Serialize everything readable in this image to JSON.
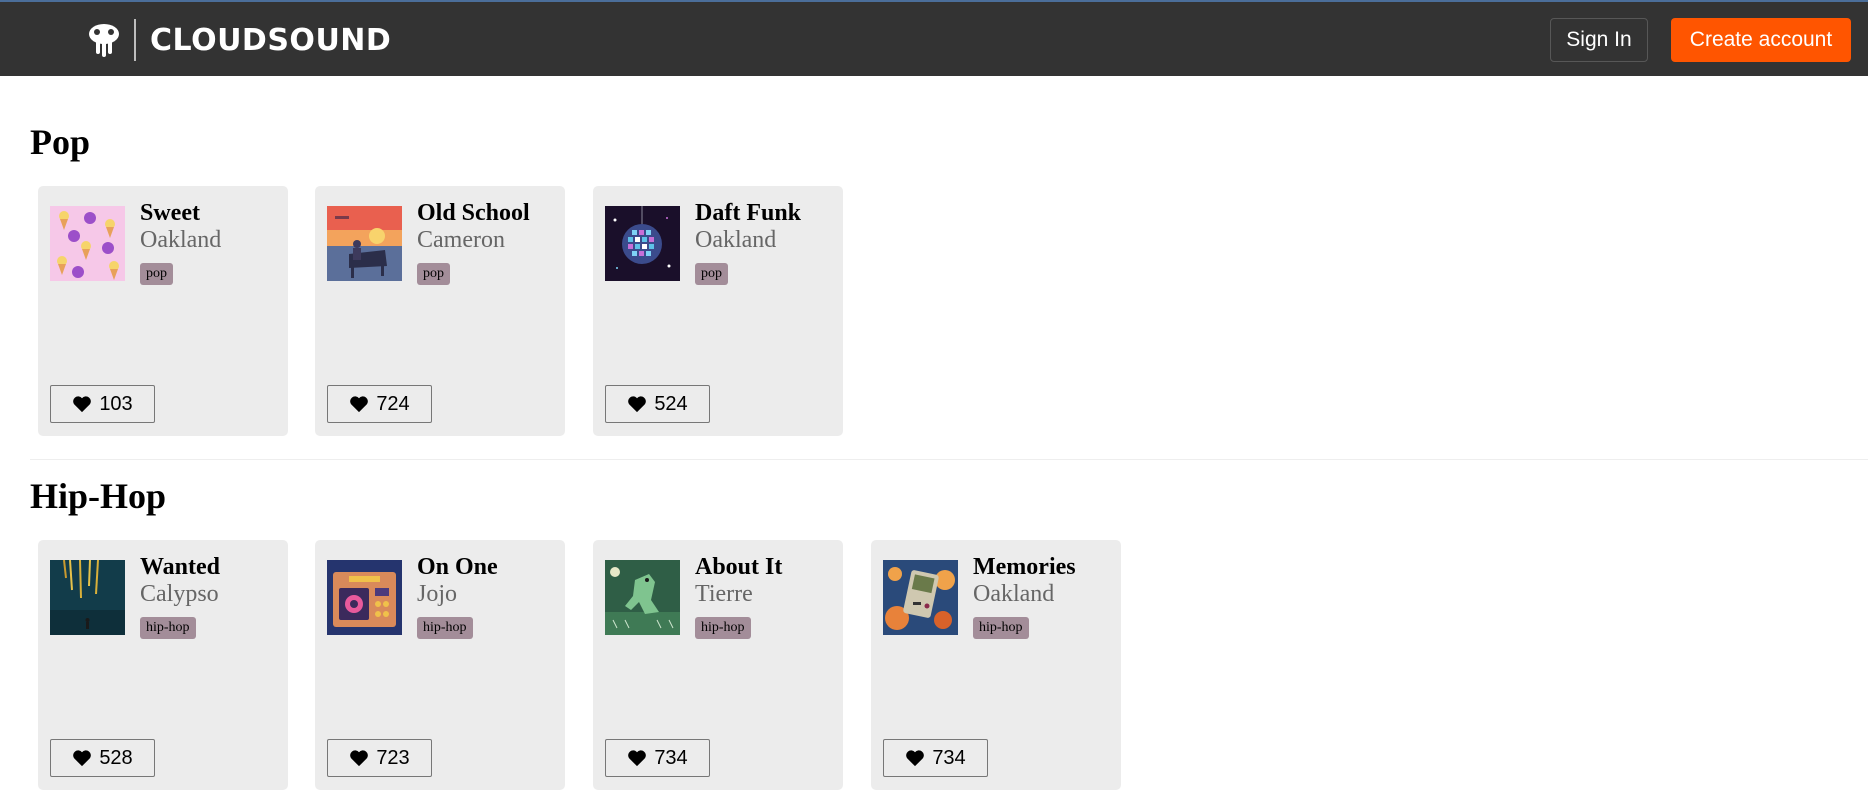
{
  "header": {
    "brand": "CLOUDSOUND",
    "sign_in_label": "Sign In",
    "create_account_label": "Create account"
  },
  "colors": {
    "header_bg": "#333333",
    "accent": "#ff5500",
    "card_bg": "#ececec",
    "tag_bg": "#a38d99"
  },
  "sections": [
    {
      "title": "Pop",
      "tracks": [
        {
          "title": "Sweet",
          "artist": "Oakland",
          "tag": "pop",
          "likes": "103",
          "art": "ice-cream-pattern"
        },
        {
          "title": "Old School",
          "artist": "Cameron",
          "tag": "pop",
          "likes": "724",
          "art": "piano-sunset"
        },
        {
          "title": "Daft Funk",
          "artist": "Oakland",
          "tag": "pop",
          "likes": "524",
          "art": "disco-ball"
        }
      ]
    },
    {
      "title": "Hip-Hop",
      "tracks": [
        {
          "title": "Wanted",
          "artist": "Calypso",
          "tag": "hip-hop",
          "likes": "528",
          "art": "night-rain"
        },
        {
          "title": "On One",
          "artist": "Jojo",
          "tag": "hip-hop",
          "likes": "723",
          "art": "retro-radio"
        },
        {
          "title": "About It",
          "artist": "Tierre",
          "tag": "hip-hop",
          "likes": "734",
          "art": "green-creature"
        },
        {
          "title": "Memories",
          "artist": "Oakland",
          "tag": "hip-hop",
          "likes": "734",
          "art": "handheld-console"
        }
      ]
    }
  ],
  "icons": {
    "logo": "cloud-logo-icon",
    "like": "heart-icon"
  }
}
